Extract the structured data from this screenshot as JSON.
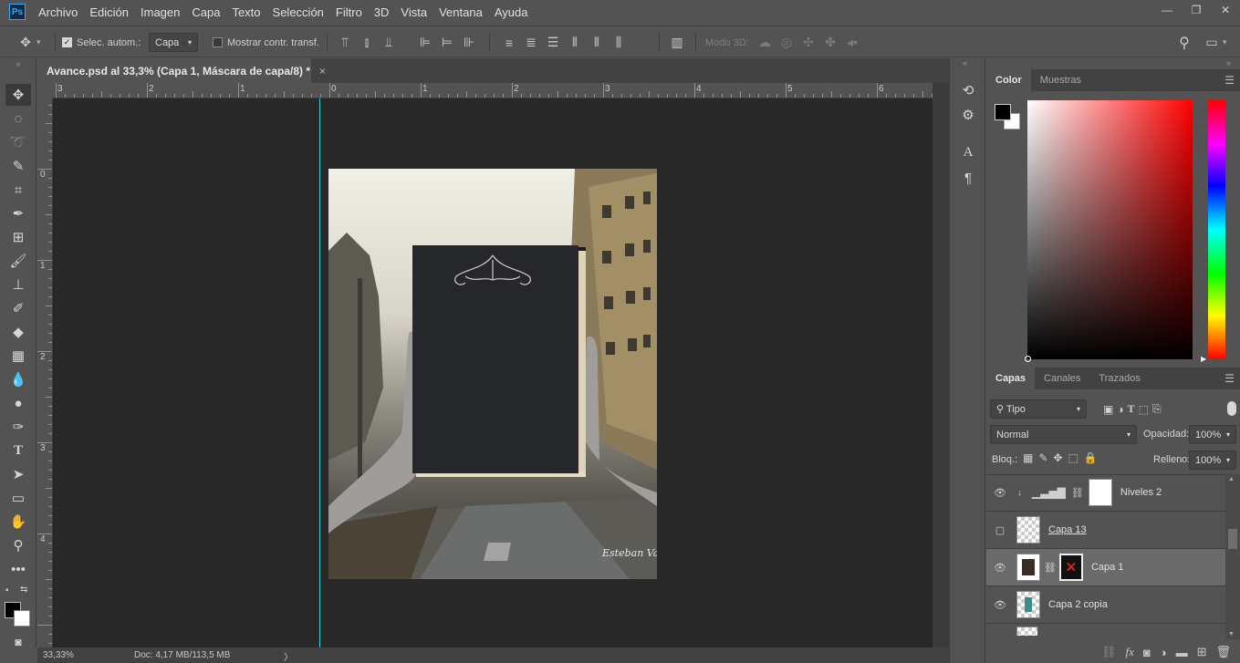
{
  "app": {
    "logo": "Ps"
  },
  "menu": [
    "Archivo",
    "Edición",
    "Imagen",
    "Capa",
    "Texto",
    "Selección",
    "Filtro",
    "3D",
    "Vista",
    "Ventana",
    "Ayuda"
  ],
  "window_controls": {
    "minimize": "—",
    "restore": "❐",
    "close": "✕"
  },
  "options": {
    "auto_select_label": "Selec. autom.:",
    "auto_select_checked": true,
    "auto_select_target": "Capa",
    "show_transform_label": "Mostrar contr. transf.",
    "show_transform_checked": false,
    "mode_3d_label": "Modo 3D:"
  },
  "document": {
    "tab_title": "Avance.psd al 33,3% (Capa 1, Máscara de capa/8) *",
    "tab_close": "×",
    "image_signature": "Esteban Vasco"
  },
  "rulers": {
    "top": [
      "3",
      "2",
      "1",
      "0",
      "1",
      "2",
      "3",
      "4",
      "5",
      "6"
    ],
    "left": [
      "0",
      "1",
      "2",
      "3",
      "4"
    ]
  },
  "status": {
    "zoom": "33,33%",
    "doc_size": "Doc: 4,17 MB/113,5 MB",
    "arrow": "〉"
  },
  "colors": {
    "foreground": "#000000",
    "background": "#ffffff",
    "guide": "#31d5d5",
    "accent": "#31a8ff"
  },
  "color_panel": {
    "tabs": [
      "Color",
      "Muestras"
    ],
    "active_tab": "Color"
  },
  "layers_panel": {
    "tabs": [
      "Capas",
      "Canales",
      "Trazados"
    ],
    "active_tab": "Capas",
    "filter_kind": "Tipo",
    "blend_mode": "Normal",
    "opacity_label": "Opacidad:",
    "opacity_value": "100%",
    "lock_label": "Bloq.:",
    "fill_label": "Relleno:",
    "fill_value": "100%",
    "layers": [
      {
        "name": "Niveles 2",
        "visible": true,
        "type": "adjustment",
        "selected": false
      },
      {
        "name": "Capa 13",
        "visible": false,
        "type": "pixel",
        "selected": false
      },
      {
        "name": "Capa 1",
        "visible": true,
        "type": "masked",
        "selected": true
      },
      {
        "name": "Capa 2 copia",
        "visible": true,
        "type": "pixel",
        "selected": false
      }
    ]
  }
}
